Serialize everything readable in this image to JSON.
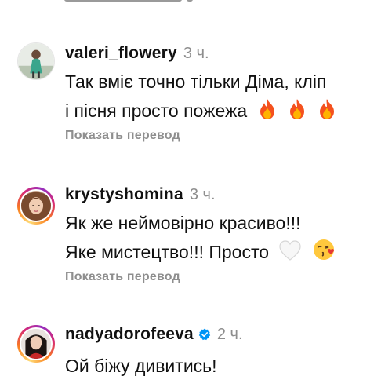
{
  "comments": [
    {
      "username": "valeri_flowery",
      "time": "3 ч.",
      "text_line1": "Так вміє точно тільки Діма, кліп",
      "text_line2": "і пісня просто пожежа",
      "emojis": [
        "fire-icon",
        "fire-icon",
        "fire-icon"
      ],
      "translate_label": "Показать перевод",
      "verified": false
    },
    {
      "username": "krystyshomina",
      "time": "3 ч.",
      "text_line1": "Як же неймовірно красиво!!!",
      "text_line2": "Яке мистецтво!!! Просто",
      "emojis": [
        "white-heart-icon",
        "kissing-face-icon"
      ],
      "translate_label": "Показать перевод",
      "verified": false
    },
    {
      "username": "nadyadorofeeva",
      "time": "2 ч.",
      "text_line1": "Ой біжу дивитись!",
      "verified": true,
      "verified_color": "#0095f6"
    }
  ],
  "colors": {
    "muted": "#8e8e8e",
    "fire": "#f4511e",
    "accent": "#0095f6"
  }
}
